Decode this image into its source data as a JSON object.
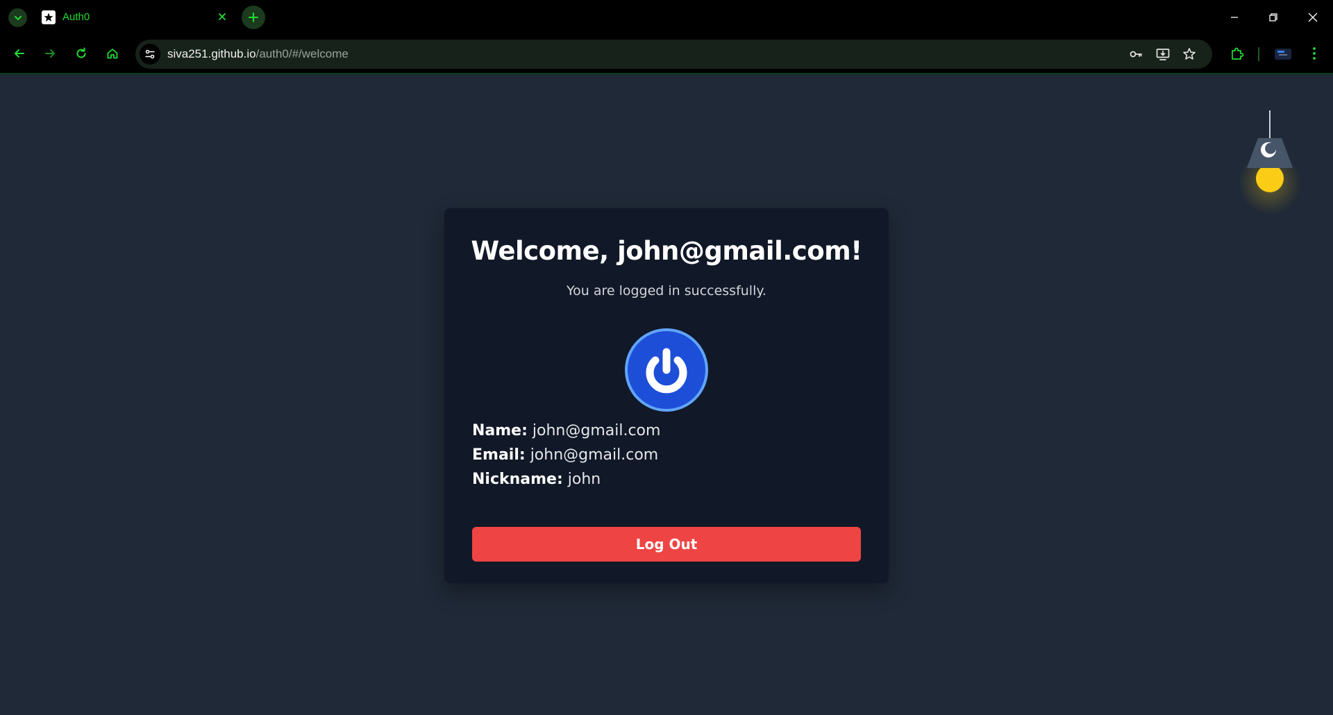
{
  "browser": {
    "tab": {
      "title": "Auth0",
      "favicon": "auth0-star-icon"
    },
    "url": {
      "host": "siva251.github.io",
      "path": "/auth0/#/welcome"
    },
    "accent_color": "#22dd33"
  },
  "page": {
    "welcome_title": "Welcome, john@gmail.com!",
    "subtitle": "You are logged in successfully.",
    "avatar_icon": "power-icon",
    "profile": [
      {
        "label": "Name:",
        "value": "john@gmail.com"
      },
      {
        "label": "Email:",
        "value": "john@gmail.com"
      },
      {
        "label": "Nickname:",
        "value": "john"
      }
    ],
    "logout_label": "Log Out",
    "theme_toggle_icon": "moon-icon",
    "colors": {
      "background": "#1f2937",
      "card": "#111827",
      "logout": "#ef4444",
      "avatar": "#1d4ed8",
      "lamp_bulb": "#facc15"
    }
  }
}
